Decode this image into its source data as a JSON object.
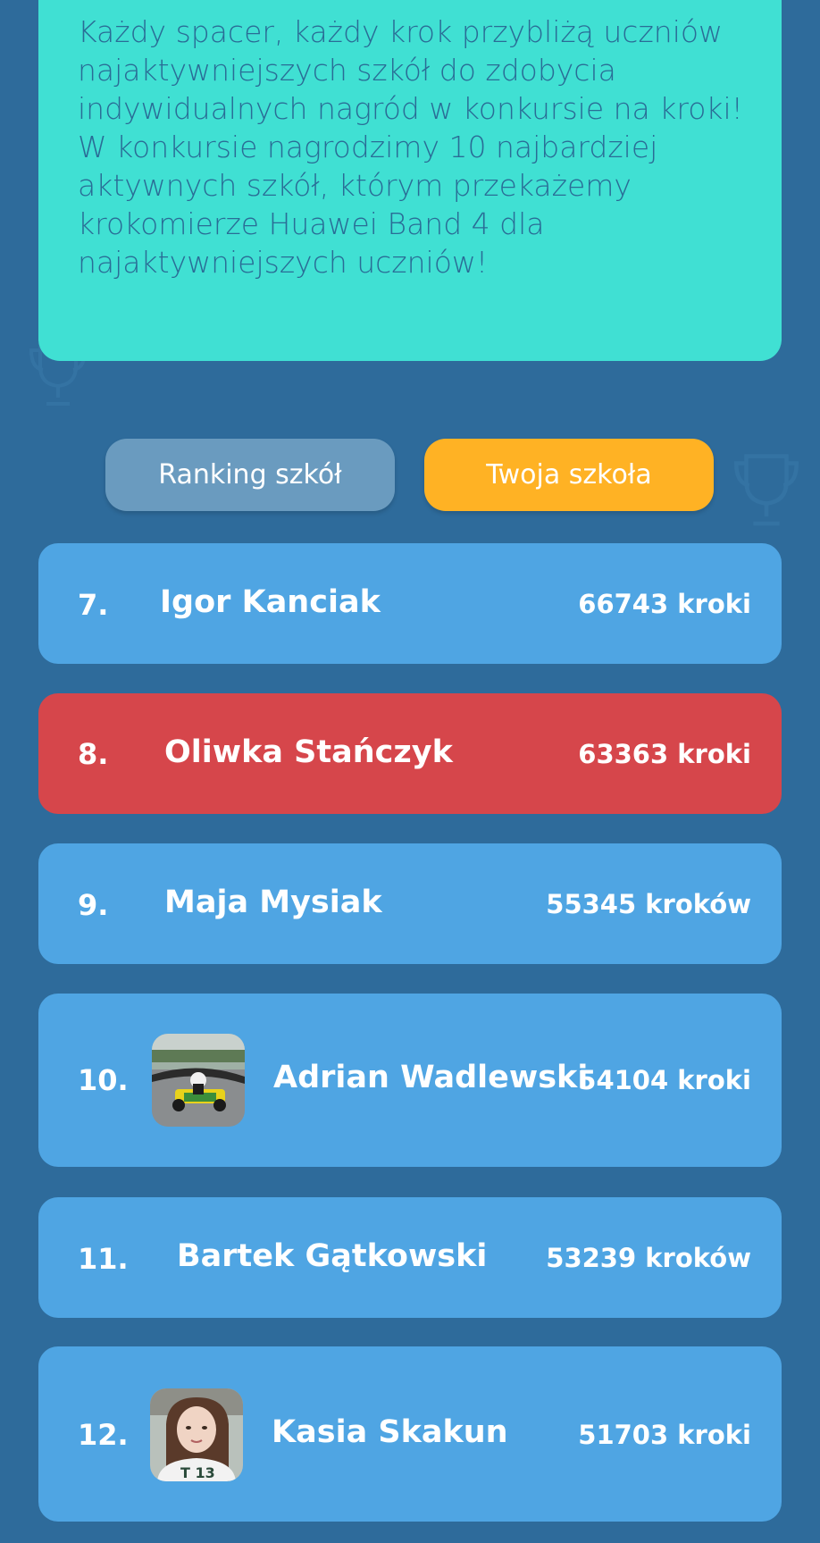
{
  "info": {
    "text": "Każdy spacer, każdy krok przybliżą uczniów najaktywniejszych szkół do zdobycia indywidualnych nagród w konkursie na kroki! W konkursie nagrodzimy 10 najbardziej aktywnych szkół, którym przekażemy krokomierze Huawei Band 4 dla najaktywniejszych uczniów!"
  },
  "tabs": {
    "ranking_label": "Ranking szkół",
    "school_label": "Twoja szkoła"
  },
  "colors": {
    "background": "#2e6b9b",
    "info_card": "#40e0d3",
    "row": "#4fa5e3",
    "row_highlight": "#d6464b",
    "tab_inactive": "#6a9bbf",
    "tab_active": "#ffb224"
  },
  "ranking": [
    {
      "rank": "7.",
      "name": "Igor Kanciak",
      "steps": "66743 kroki"
    },
    {
      "rank": "8.",
      "name": "Oliwka Stańczyk",
      "steps": "63363 kroki",
      "highlighted": true
    },
    {
      "rank": "9.",
      "name": "Maja Mysiak",
      "steps": "55345 kroków"
    },
    {
      "rank": "10.",
      "name": "Adrian Wadlewski",
      "steps": "54104 kroki",
      "avatar": "go-kart-photo"
    },
    {
      "rank": "11.",
      "name": "Bartek Gątkowski",
      "steps": "53239 kroków"
    },
    {
      "rank": "12.",
      "name": "Kasia Skakun",
      "steps": "51703 kroki",
      "avatar": "girl-portrait-photo"
    }
  ]
}
